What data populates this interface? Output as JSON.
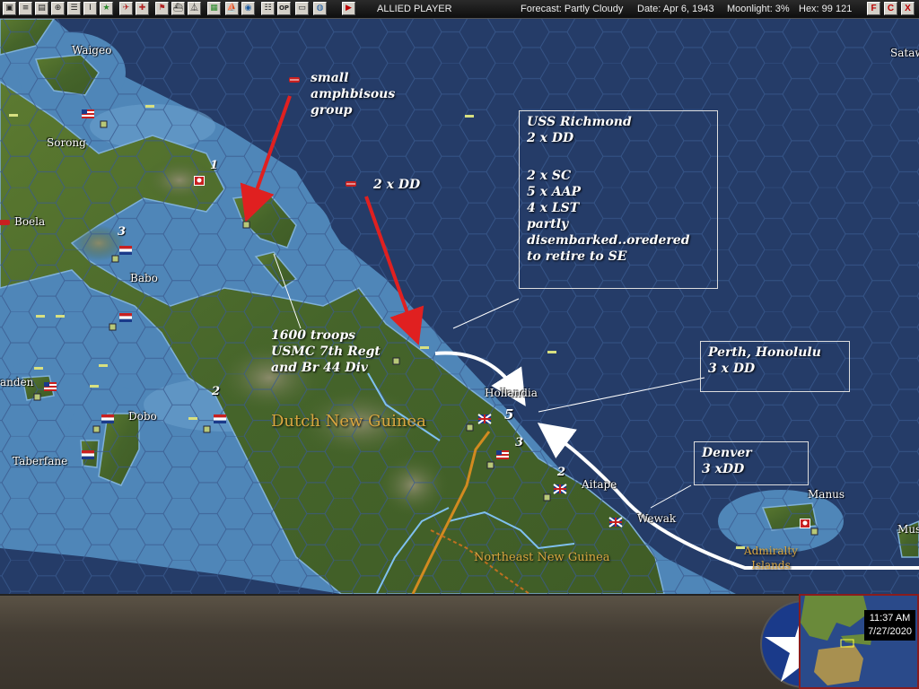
{
  "toolbar": {
    "icons": [
      "save-icon",
      "report-icon",
      "base-icon",
      "air-icon",
      "info-icon",
      "unit-icon",
      "plane-icon",
      "flag-icon",
      "ship-icon",
      "sub-icon",
      "army-icon",
      "globe-icon",
      "list-icon",
      "op-icon",
      "message-icon",
      "weather-icon",
      "end-turn-icon"
    ],
    "op_label": "OP",
    "info_label": "I",
    "side": "ALLIED PLAYER",
    "forecast": "Forecast: Partly Cloudy",
    "date": "Date: Apr 6, 1943",
    "moonlight": "Moonlight: 3%",
    "hex": "Hex: 99 121",
    "right_buttons": [
      "F",
      "C",
      "X"
    ]
  },
  "map": {
    "places": {
      "waigeo": "Waigeo",
      "sorong": "Sorong",
      "boela": "Boela",
      "babo": "Babo",
      "fakfak": "anden",
      "dobo": "Dobo",
      "taberfane": "Taberfane",
      "hollandia": "Hollandia",
      "aitape": "Aitape",
      "wewak": "Wewak",
      "manus": "Manus",
      "satawan": "Sataw",
      "mus": "Mus"
    },
    "regions": {
      "dutch_new_guinea": "Dutch New Guinea",
      "northeast_new_guinea": "Northeast New Guinea",
      "admiralty": "Admiralty Islands"
    },
    "stack_numbers": [
      "1",
      "3",
      "2",
      "5",
      "3",
      "2"
    ],
    "annotations": {
      "small_group": [
        "small",
        "amphbisous",
        "group"
      ],
      "two_dd": "2 x DD",
      "troops": [
        "1600 troops",
        "USMC 7th Regt",
        "and Br 44 Div"
      ],
      "richmond": [
        "USS Richmond",
        " 2 x DD",
        "",
        " 2 x SC",
        " 5 x AAP",
        " 4 x LST",
        " partly",
        " disembarked..oredered",
        " to retire to SE"
      ],
      "perth": [
        "Perth, Honolulu",
        "3 x DD"
      ],
      "denver": [
        "Denver",
        "3 xDD"
      ]
    }
  },
  "minimap": {
    "time": "11:37 AM",
    "date": "7/27/2020"
  },
  "colors": {
    "deep_sea": "#253c68",
    "shallow_sea": "#4f86b8",
    "land": "#4b6b2a",
    "arrow_red": "#e02020",
    "arrow_white": "#ffffff"
  }
}
